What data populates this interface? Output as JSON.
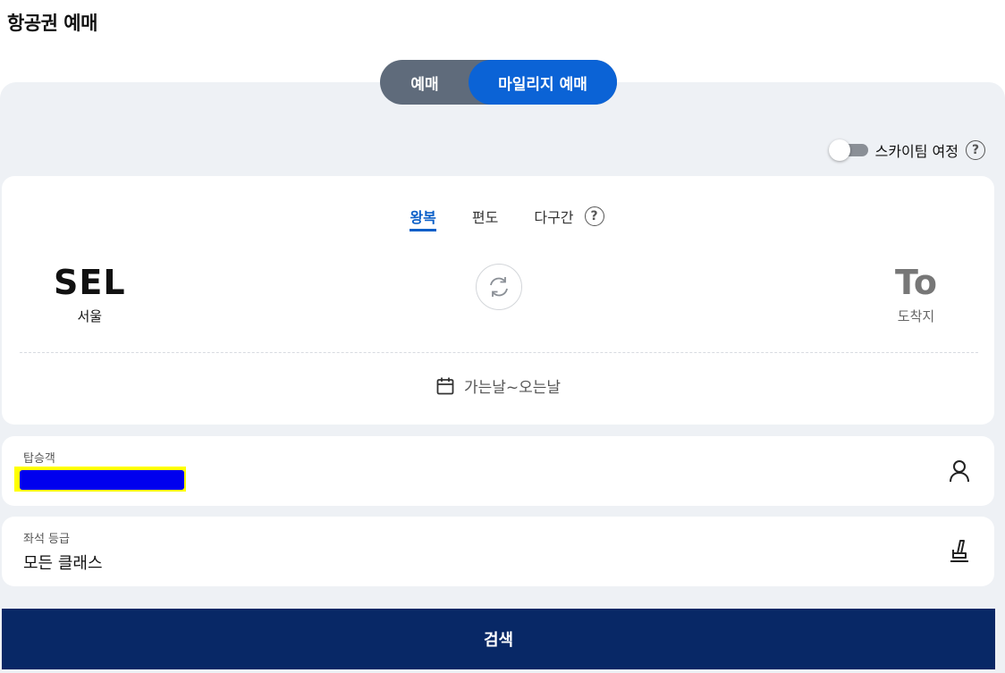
{
  "page": {
    "title": "항공권 예매"
  },
  "booking_mode": {
    "options": [
      "예매",
      "마일리지 예매"
    ],
    "selected": "마일리지 예매"
  },
  "skyteam": {
    "label": "스카이팀 여정",
    "enabled": false
  },
  "trip_types": {
    "items": [
      "왕복",
      "편도",
      "다구간"
    ],
    "selected": "왕복"
  },
  "route": {
    "origin": {
      "code": "SEL",
      "city": "서울"
    },
    "destination": {
      "code": "To",
      "city": "도착지"
    }
  },
  "dates": {
    "label": "가는날~오는날"
  },
  "passengers": {
    "label": "탑승객",
    "value": ""
  },
  "seat_class": {
    "label": "좌석 등급",
    "value": "모든 클래스"
  },
  "search": {
    "label": "검색"
  },
  "colors": {
    "accent": "#0b63d6",
    "primary_button": "#082866",
    "panel_bg": "#eef1f5"
  },
  "icons": {
    "help": "question-circle-icon",
    "swap": "swap-arrows-icon",
    "calendar": "calendar-icon",
    "person": "person-icon",
    "seat": "seat-icon"
  }
}
